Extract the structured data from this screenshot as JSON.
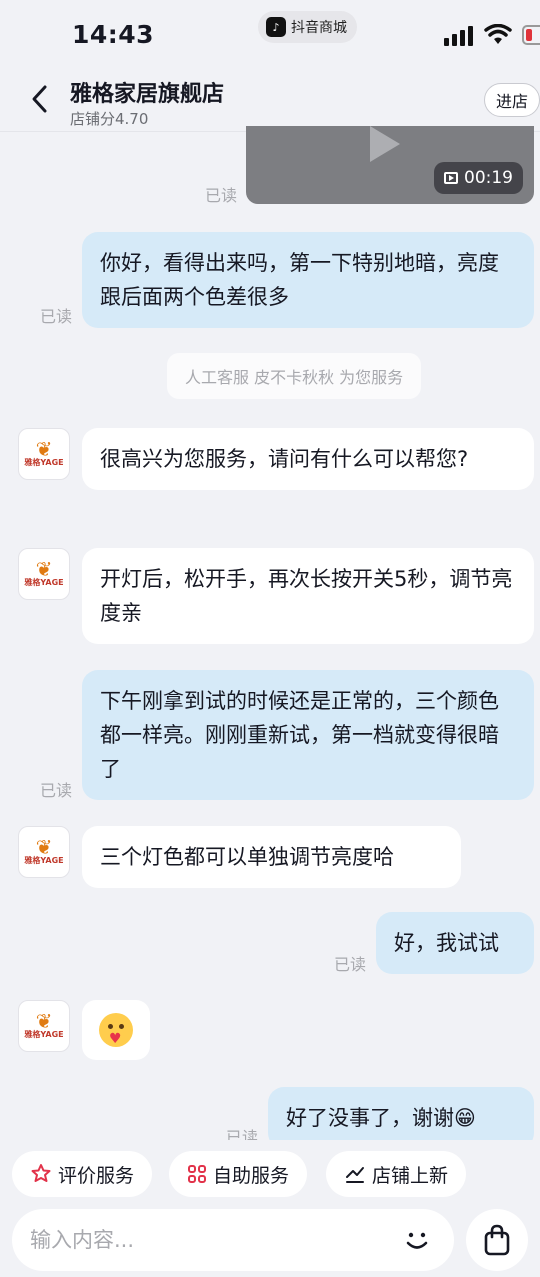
{
  "status_bar": {
    "time": "14:43",
    "mall_label": "抖音商城"
  },
  "header": {
    "store_name": "雅格家居旗舰店",
    "store_score": "店铺分4.70",
    "enter_label": "进店"
  },
  "video": {
    "duration": "00:19",
    "read": "已读"
  },
  "messages": [
    {
      "from": "me",
      "text": "你好，看得出来吗，第一下特别地暗，亮度跟后面两个色差很多",
      "read": "已读"
    },
    {
      "from": "system",
      "text": "人工客服 皮不卡秋秋 为您服务"
    },
    {
      "from": "them",
      "text": "很高兴为您服务，请问有什么可以帮您?"
    },
    {
      "from": "them",
      "text": "开灯后，松开手，再次长按开关5秒，调节亮度亲"
    },
    {
      "from": "me",
      "text": "下午刚拿到试的时候还是正常的，三个颜色都一样亮。刚刚重新试，第一档就变得很暗了",
      "read": "已读"
    },
    {
      "from": "them",
      "text": "三个灯色都可以单独调节亮度哈"
    },
    {
      "from": "me",
      "text": "好，我试试",
      "read": "已读"
    },
    {
      "from": "them",
      "text": "",
      "emoji": "heart-face-emoji"
    },
    {
      "from": "me",
      "text": "好了没事了，谢谢😁",
      "read": "已读"
    }
  ],
  "avatar_brand": "雅格YAGE",
  "quick_actions": [
    {
      "label": "评价服务",
      "icon": "flower-icon"
    },
    {
      "label": "自助服务",
      "icon": "grid-icon"
    },
    {
      "label": "店铺上新",
      "icon": "new-tag-icon"
    }
  ],
  "input": {
    "placeholder": "输入内容..."
  }
}
